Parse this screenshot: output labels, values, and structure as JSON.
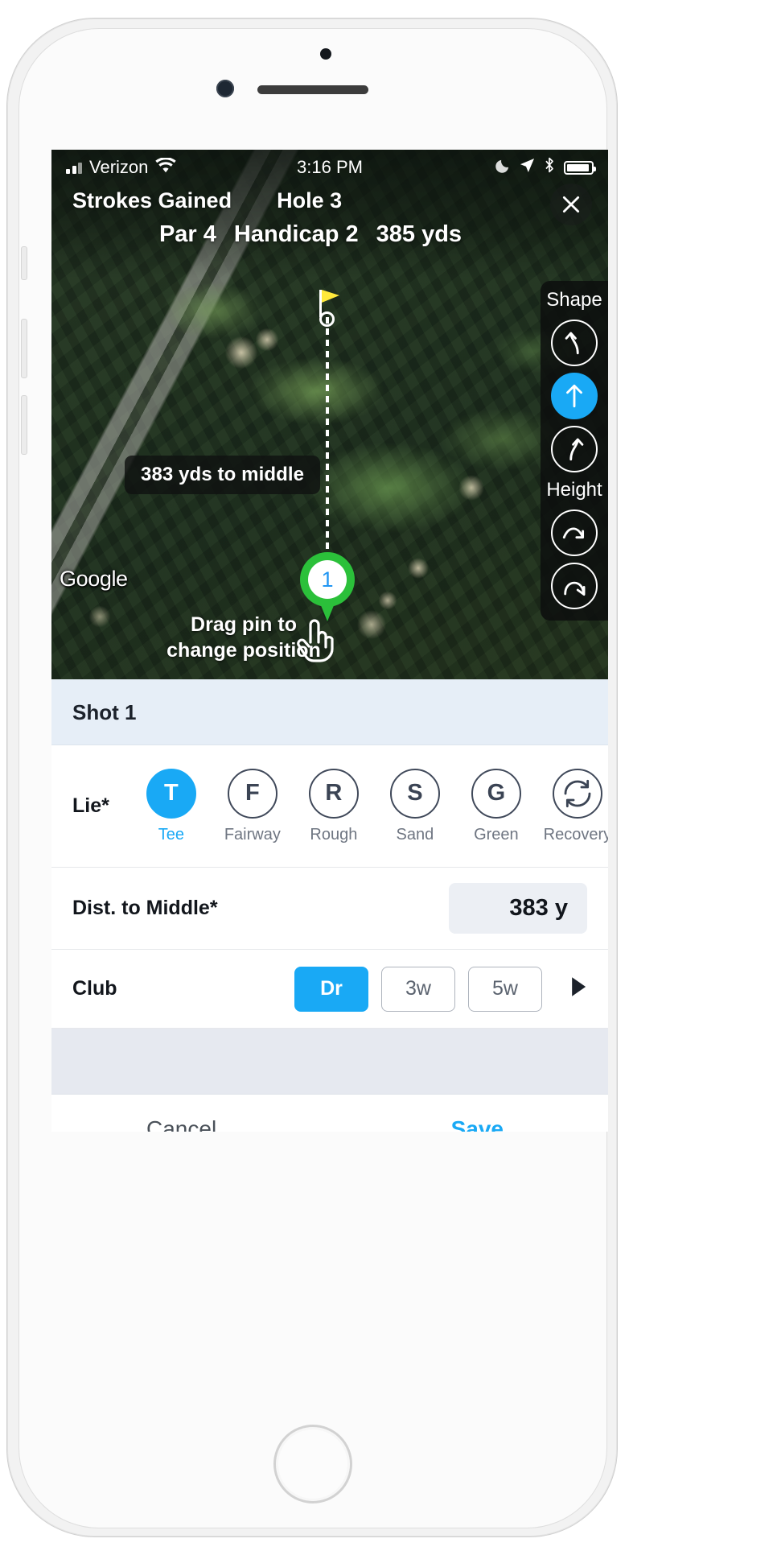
{
  "status_bar": {
    "carrier": "Verizon",
    "time": "3:16 PM",
    "wifi_icon": "wifi-icon",
    "signal_icon": "signal-bars-icon",
    "moon_icon": "moon-icon",
    "location_icon": "location-arrow-icon",
    "bluetooth_icon": "bluetooth-icon",
    "battery_icon": "battery-icon"
  },
  "header": {
    "title": "Strokes Gained",
    "hole": "Hole 3",
    "par": "Par 4",
    "handicap": "Handicap 2",
    "yardage": "385 yds",
    "close_icon": "close-icon"
  },
  "map": {
    "distance_chip": "383 yds to middle",
    "pin_number": "1",
    "drag_hint_line1": "Drag pin to",
    "drag_hint_line2": "change position",
    "attribution": "Google",
    "hand_icon": "pointing-hand-icon",
    "flag_icon": "golf-flag-icon"
  },
  "shape_panel": {
    "shape_label": "Shape",
    "height_label": "Height",
    "shape_options": [
      {
        "name": "shape-draw",
        "selected": false
      },
      {
        "name": "shape-straight",
        "selected": true
      },
      {
        "name": "shape-fade",
        "selected": false
      }
    ],
    "height_options": [
      {
        "name": "height-low",
        "selected": false
      },
      {
        "name": "height-high",
        "selected": false
      }
    ],
    "accent_color": "#19a9f5"
  },
  "form": {
    "shot_title": "Shot 1",
    "lie": {
      "label": "Lie*",
      "options": [
        {
          "letter": "T",
          "name": "Tee",
          "selected": true
        },
        {
          "letter": "F",
          "name": "Fairway",
          "selected": false
        },
        {
          "letter": "R",
          "name": "Rough",
          "selected": false
        },
        {
          "letter": "S",
          "name": "Sand",
          "selected": false
        },
        {
          "letter": "G",
          "name": "Green",
          "selected": false
        },
        {
          "letter": "",
          "name": "Recovery",
          "selected": false,
          "icon": "recovery-loop-icon"
        }
      ]
    },
    "distance": {
      "label": "Dist. to Middle*",
      "value": "383 y"
    },
    "club": {
      "label": "Club",
      "options": [
        {
          "label": "Dr",
          "selected": true
        },
        {
          "label": "3w",
          "selected": false
        },
        {
          "label": "5w",
          "selected": false
        }
      ],
      "next_icon": "play-arrow-icon"
    }
  },
  "footer": {
    "cancel_label": "Cancel",
    "save_label": "Save"
  },
  "colors": {
    "accent": "#19a9f5",
    "pin_green": "#2bc03a",
    "header_band": "#e6eef7",
    "spacer": "#e6e9f0"
  }
}
